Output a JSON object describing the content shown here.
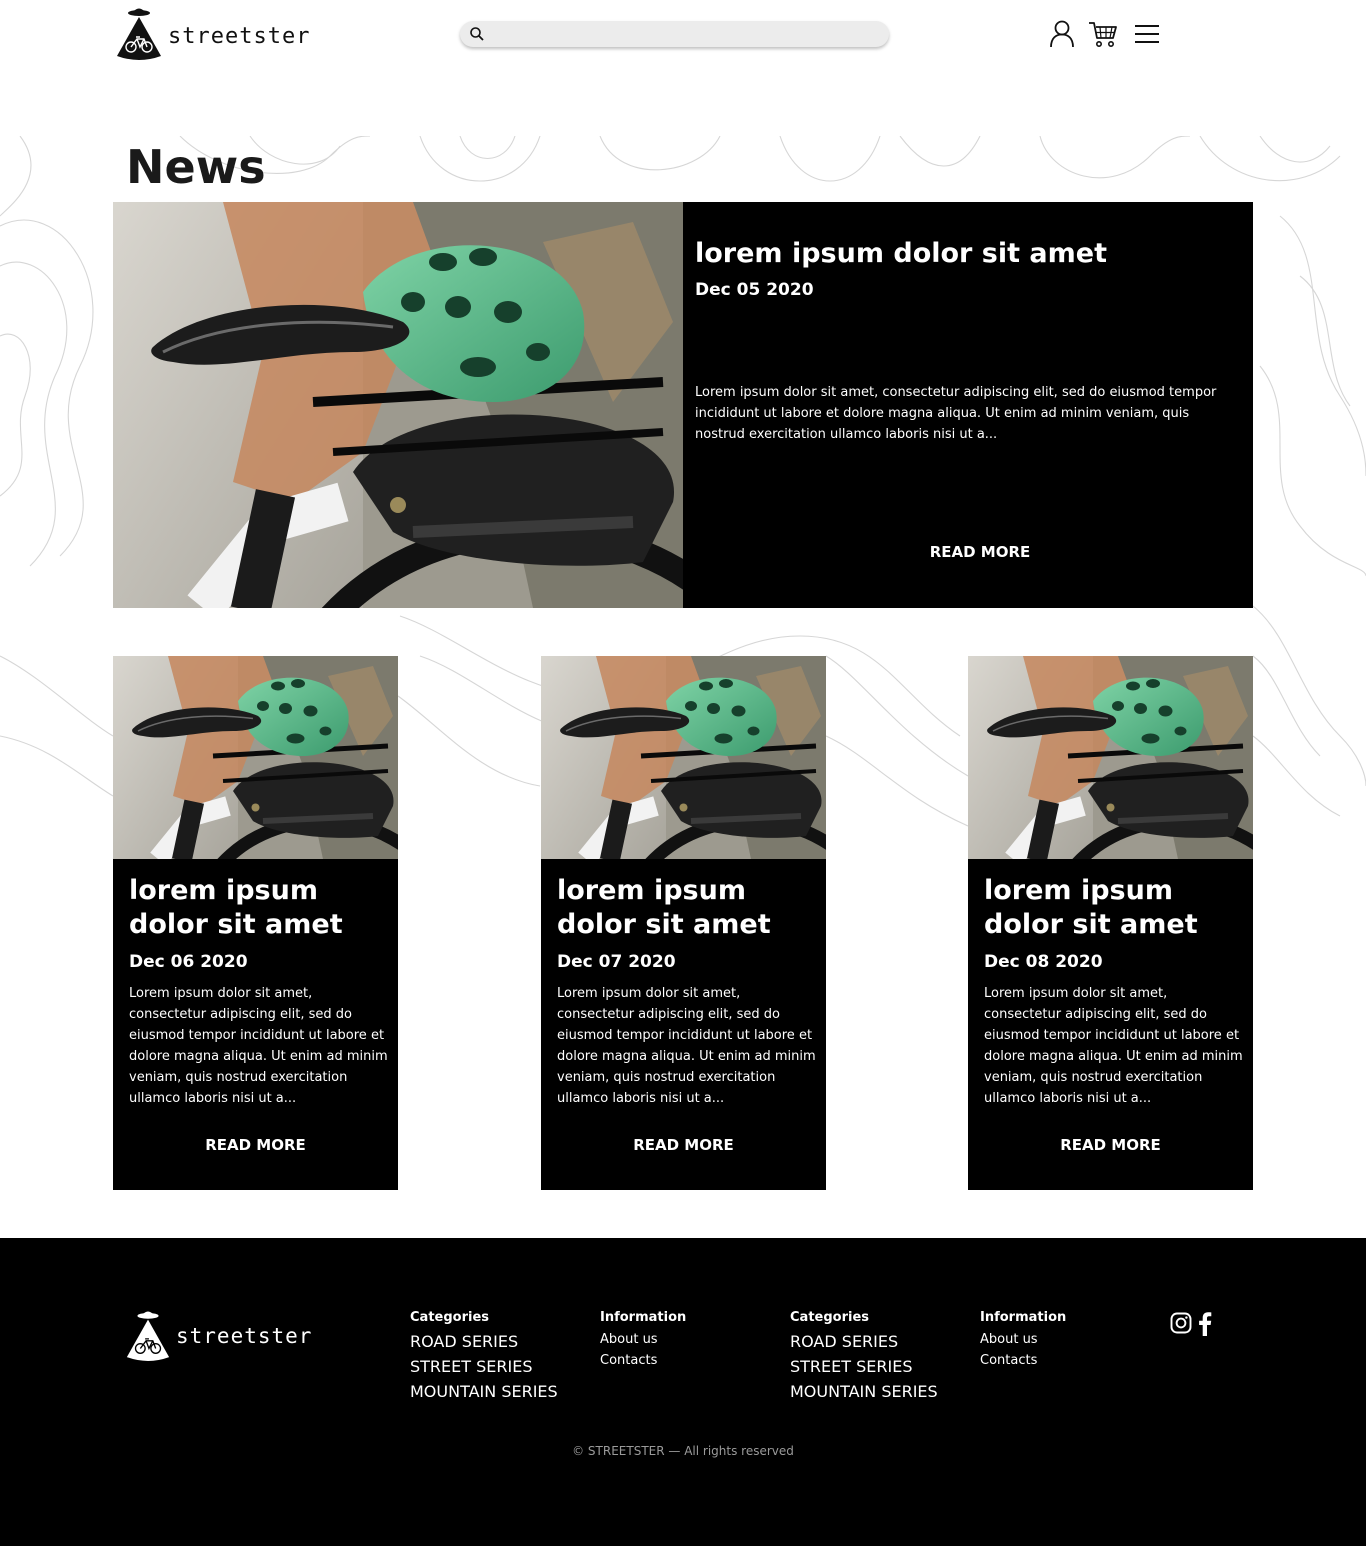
{
  "header": {
    "logo_text": "streetster",
    "search": {
      "placeholder": "",
      "value": ""
    },
    "icons": [
      "user-icon",
      "cart-icon",
      "menu-icon"
    ]
  },
  "page_title": "News",
  "featured": {
    "title": "lorem ipsum dolor sit amet",
    "date": "Dec 05 2020",
    "excerpt": "Lorem ipsum dolor sit amet, consectetur adipiscing elit, sed do eiusmod tempor incididunt ut labore et dolore magna aliqua. Ut enim ad minim veniam, quis nostrud exercitation ullamco laboris nisi ut a...",
    "read_more": "READ MORE"
  },
  "cards": [
    {
      "title": "lorem ipsum dolor sit amet",
      "date": "Dec 06 2020",
      "excerpt": "Lorem ipsum dolor sit amet, consectetur adipiscing elit, sed do eiusmod tempor incididunt ut labore et dolore magna aliqua. Ut enim ad minim veniam, quis nostrud exercitation ullamco laboris nisi ut a...",
      "read_more": "READ MORE"
    },
    {
      "title": "lorem ipsum dolor sit amet",
      "date": "Dec 07 2020",
      "excerpt": "Lorem ipsum dolor sit amet, consectetur adipiscing elit, sed do eiusmod tempor incididunt ut labore et dolore magna aliqua. Ut enim ad minim veniam, quis nostrud exercitation ullamco laboris nisi ut a...",
      "read_more": "READ MORE"
    },
    {
      "title": "lorem ipsum dolor sit amet",
      "date": "Dec 08 2020",
      "excerpt": "Lorem ipsum dolor sit amet, consectetur adipiscing elit, sed do eiusmod tempor incididunt ut labore et dolore magna aliqua. Ut enim ad minim veniam, quis nostrud exercitation ullamco laboris nisi ut a...",
      "read_more": "READ MORE"
    }
  ],
  "footer": {
    "logo_text": "streetster",
    "columns": [
      {
        "heading": "Categories",
        "items": [
          "ROAD SERIES",
          "STREET SERIES",
          "MOUNTAIN SERIES"
        ]
      },
      {
        "heading": "Information",
        "items": [
          "About us",
          "Contacts"
        ]
      },
      {
        "heading": "Categories",
        "items": [
          "ROAD SERIES",
          "STREET SERIES",
          "MOUNTAIN SERIES"
        ]
      },
      {
        "heading": "Information",
        "items": [
          "About us",
          "Contacts"
        ]
      }
    ],
    "social": [
      "instagram-icon",
      "facebook-icon"
    ],
    "copyright": "© STREETSTER — All rights reserved"
  }
}
